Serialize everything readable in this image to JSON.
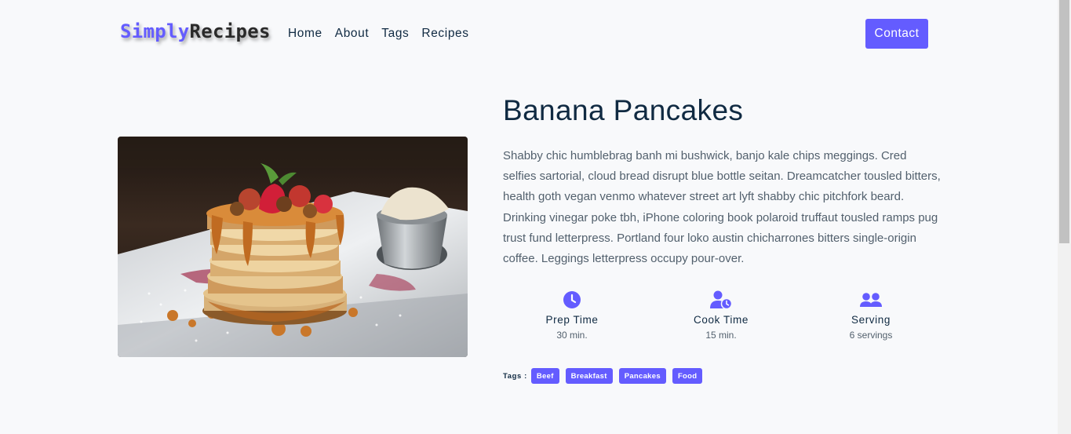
{
  "brand": {
    "part1": "Simply",
    "part2": "Recipes"
  },
  "nav": {
    "links": [
      "Home",
      "About",
      "Tags",
      "Recipes"
    ],
    "contact_label": "Contact"
  },
  "recipe": {
    "image_alt": "Banana Pancakes",
    "title": "Banana Pancakes",
    "description": "Shabby chic humblebrag banh mi bushwick, banjo kale chips meggings. Cred selfies sartorial, cloud bread disrupt blue bottle seitan. Dreamcatcher tousled bitters, health goth vegan venmo whatever street art lyft shabby chic pitchfork beard. Drinking vinegar poke tbh, iPhone coloring book polaroid truffaut tousled ramps pug trust fund letterpress. Portland four loko austin chicharrones bitters single-origin coffee. Leggings letterpress occupy pour-over.",
    "stats": [
      {
        "icon": "clock-icon",
        "label": "Prep Time",
        "value": "30 min."
      },
      {
        "icon": "user-clock-icon",
        "label": "Cook Time",
        "value": "15 min."
      },
      {
        "icon": "users-icon",
        "label": "Serving",
        "value": "6 servings"
      }
    ],
    "tags_label": "Tags :",
    "tags": [
      "Beef",
      "Breakfast",
      "Pancakes",
      "Food"
    ]
  },
  "colors": {
    "accent": "#645cff",
    "heading": "#102a42",
    "body_text": "#52606d",
    "background": "#f8f9fb"
  }
}
